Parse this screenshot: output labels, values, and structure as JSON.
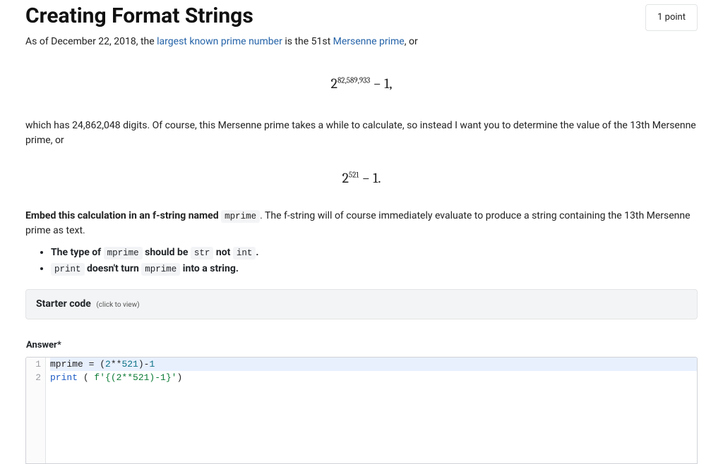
{
  "header": {
    "title": "Creating Format Strings",
    "points": "1 point"
  },
  "intro": {
    "prefix": "As of December 22, 2018, the ",
    "link1": "largest known prime number",
    "mid": " is the 51st ",
    "link2": "Mersenne prime",
    "suffix": ", or"
  },
  "formula1": {
    "base": "2",
    "exponent": "82,589,933",
    "tail": " − 1,"
  },
  "para1": "which has 24,862,048 digits. Of course, this Mersenne prime takes a while to calculate, so instead I want you to determine the value of the 13th Mersenne prime, or",
  "formula2": {
    "base": "2",
    "exponent": "521",
    "tail": " − 1."
  },
  "embed": {
    "strong1": "Embed this calculation in an f-string named ",
    "code1": "mprime",
    "after": ". The f-string will of course immediately evaluate to produce a string containing the 13th Mersenne prime as text."
  },
  "bullets": {
    "b1_pre": "The type of ",
    "b1_code1": "mprime",
    "b1_mid": " should be ",
    "b1_code2": "str",
    "b1_mid2": " not ",
    "b1_code3": "int",
    "b1_post": ".",
    "b2_code1": "print",
    "b2_mid": " doesn't turn ",
    "b2_code2": "mprime",
    "b2_post": " into a string."
  },
  "starter": {
    "label": "Starter code",
    "hint": "(click to view)"
  },
  "answer": {
    "label": "Answer*",
    "lines": {
      "ln1": "1",
      "ln2": "2"
    },
    "code": {
      "l1_ident": "mprime ",
      "l1_eq": "= (",
      "l1_num1": "2",
      "l1_pow": "**",
      "l1_num2": "521",
      "l1_close": ")-",
      "l1_num3": "1",
      "l2_print": "print",
      "l2_sp": " ( ",
      "l2_str": "f'{(2**521)-1}'",
      "l2_close": ")"
    }
  }
}
